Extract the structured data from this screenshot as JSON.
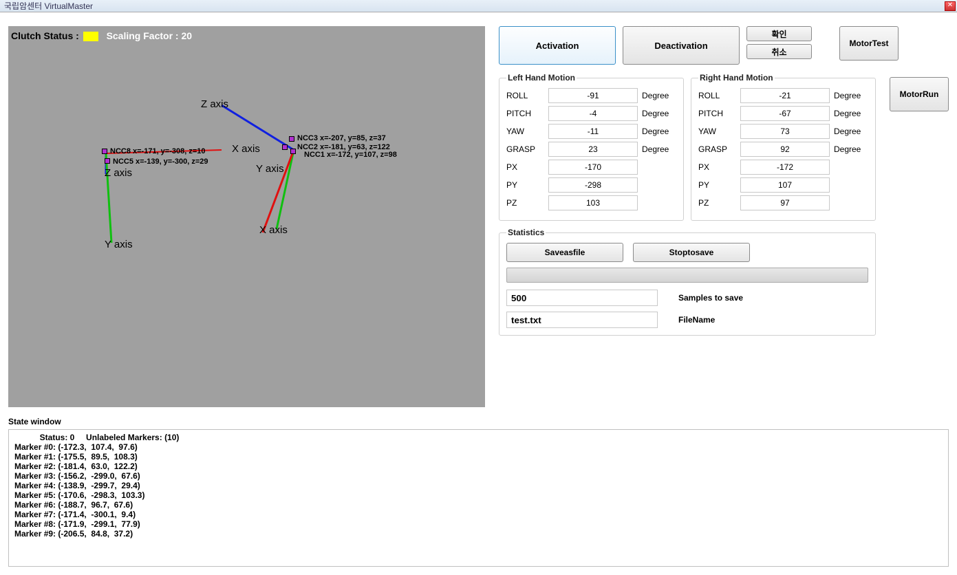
{
  "window": {
    "title": "국립암센터 VirtualMaster"
  },
  "viewport": {
    "clutch_label": "Clutch Status :",
    "scaling_label": "Scaling Factor : 20",
    "markers": [
      {
        "name": "NCC3",
        "text": "NCC3   x=-207, y=85, z=37"
      },
      {
        "name": "NCC2",
        "text": "NCC2   x=-181, y=63, z=122"
      },
      {
        "name": "NCC1",
        "text": "NCC1   x=-172, y=107, z=98"
      },
      {
        "name": "NCC8",
        "text": "NCC8   x=-171, y=-308, z=10"
      },
      {
        "name": "NCC5",
        "text": "NCC5   x=-139, y=-300, z=29"
      }
    ],
    "axis_labels": [
      "Z axis",
      "X axis",
      "Y axis",
      "Z axis",
      "Y axis",
      "X axis"
    ]
  },
  "buttons": {
    "activation": "Activation",
    "deactivation": "Deactivation",
    "confirm": "확인",
    "cancel": "취소",
    "motortest": "MotorTest",
    "motorrun": "MotorRun",
    "saveasfile": "Saveasfile",
    "stoptosave": "Stoptosave"
  },
  "left_motion": {
    "title": "Left Hand Motion",
    "rows": [
      {
        "label": "ROLL",
        "value": "-91",
        "unit": "Degree"
      },
      {
        "label": "PITCH",
        "value": "-4",
        "unit": "Degree"
      },
      {
        "label": "YAW",
        "value": "-11",
        "unit": "Degree"
      },
      {
        "label": "GRASP",
        "value": "23",
        "unit": "Degree"
      },
      {
        "label": "PX",
        "value": "-170",
        "unit": ""
      },
      {
        "label": "PY",
        "value": "-298",
        "unit": ""
      },
      {
        "label": "PZ",
        "value": "103",
        "unit": ""
      }
    ]
  },
  "right_motion": {
    "title": "Right Hand Motion",
    "rows": [
      {
        "label": "ROLL",
        "value": "-21",
        "unit": "Degree"
      },
      {
        "label": "PITCH",
        "value": "-67",
        "unit": "Degree"
      },
      {
        "label": "YAW",
        "value": "73",
        "unit": "Degree"
      },
      {
        "label": "GRASP",
        "value": "92",
        "unit": "Degree"
      },
      {
        "label": "PX",
        "value": "-172",
        "unit": ""
      },
      {
        "label": "PY",
        "value": "107",
        "unit": ""
      },
      {
        "label": "PZ",
        "value": "97",
        "unit": ""
      }
    ]
  },
  "statistics": {
    "title": "Statistics",
    "samples_value": "500",
    "samples_label": "Samples to save",
    "filename_value": "test.txt",
    "filename_label": "FileName"
  },
  "state": {
    "title": "State window",
    "header": "           Status: 0     Unlabeled Markers: (10)",
    "lines": [
      "Marker #0: (-172.3,  107.4,  97.6)",
      "Marker #1: (-175.5,  89.5,  108.3)",
      "Marker #2: (-181.4,  63.0,  122.2)",
      "Marker #3: (-156.2,  -299.0,  67.6)",
      "Marker #4: (-138.9,  -299.7,  29.4)",
      "Marker #5: (-170.6,  -298.3,  103.3)",
      "Marker #6: (-188.7,  96.7,  67.6)",
      "Marker #7: (-171.4,  -300.1,  9.4)",
      "Marker #8: (-171.9,  -299.1,  77.9)",
      "Marker #9: (-206.5,  84.8,  37.2)"
    ]
  }
}
